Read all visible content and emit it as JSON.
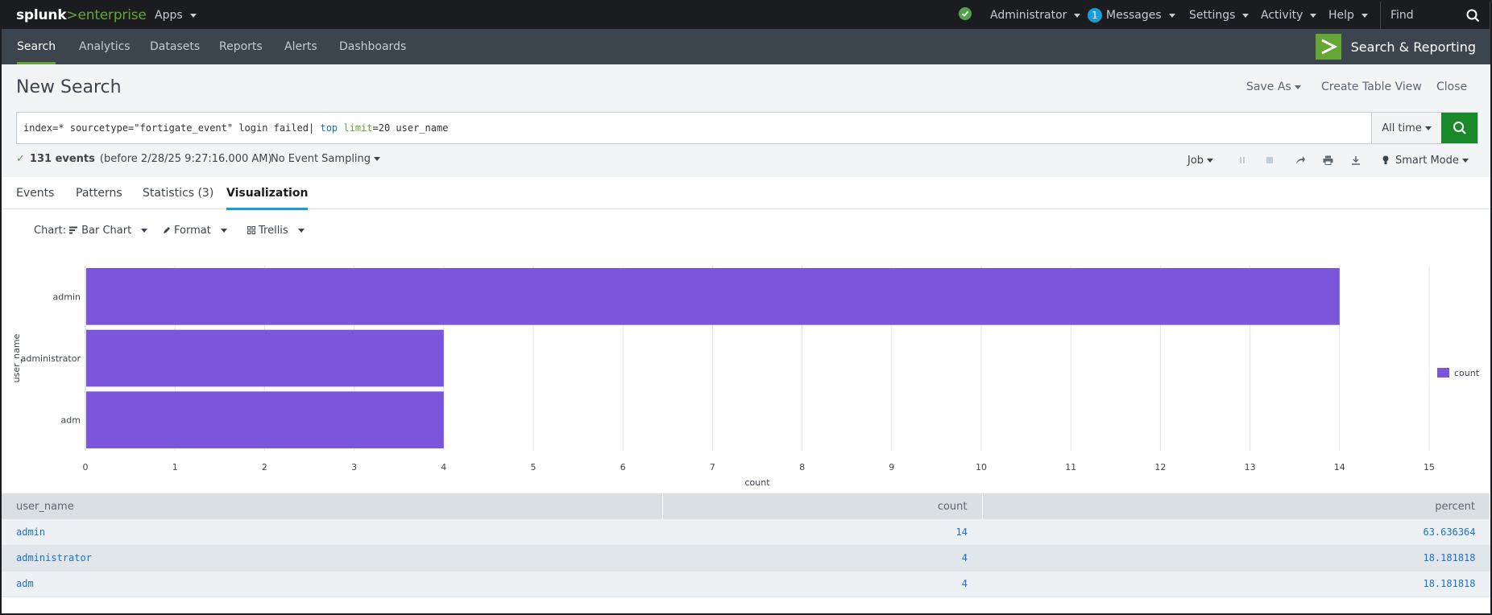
{
  "topbar": {
    "logo_splunk": "splunk",
    "logo_gt": ">",
    "logo_enterprise": "enterprise",
    "apps": "Apps",
    "user": "Administrator",
    "messages_count": "1",
    "messages": "Messages",
    "settings": "Settings",
    "activity": "Activity",
    "help": "Help",
    "find_placeholder": "Find"
  },
  "appbar": {
    "tabs": [
      "Search",
      "Analytics",
      "Datasets",
      "Reports",
      "Alerts",
      "Dashboards"
    ],
    "active_tab": "Search",
    "app_name": "Search & Reporting"
  },
  "search": {
    "page_title": "New Search",
    "save_as": "Save As",
    "create_table_view": "Create Table View",
    "close": "Close",
    "query_part1": "index=* sourcetype=\"fortigate_event\" login failed| ",
    "query_cmd": "top",
    "query_space": " ",
    "query_arg": "limit",
    "query_part2": "=20 user_name",
    "time_range": "All time",
    "events_count": "131 events",
    "events_before": "(before 2/28/25 9:27:16.000 AM)",
    "sampling": "No Event Sampling",
    "job": "Job",
    "mode": "Smart Mode"
  },
  "result_tabs": {
    "events": "Events",
    "patterns": "Patterns",
    "statistics": "Statistics (3)",
    "visualization": "Visualization"
  },
  "viz_toolbar": {
    "chart_label": "Chart:",
    "chart_type": "Bar Chart",
    "format": "Format",
    "trellis": "Trellis"
  },
  "colors": {
    "bar": "#7b56db",
    "accent_green": "#65a637",
    "accent_blue": "#1a9cd9"
  },
  "chart_data": {
    "type": "bar",
    "orientation": "horizontal",
    "categories": [
      "admin",
      "administrator",
      "adm"
    ],
    "series": [
      {
        "name": "count",
        "values": [
          14,
          4,
          4
        ]
      }
    ],
    "xlabel": "count",
    "ylabel": "user_name",
    "xlim": [
      0,
      15
    ],
    "xticks": [
      0,
      1,
      2,
      3,
      4,
      5,
      6,
      7,
      8,
      9,
      10,
      11,
      12,
      13,
      14,
      15
    ],
    "grid": true,
    "legend": "right"
  },
  "table": {
    "columns": [
      "user_name",
      "count",
      "percent"
    ],
    "rows": [
      [
        "admin",
        "14",
        "63.636364"
      ],
      [
        "administrator",
        "4",
        "18.181818"
      ],
      [
        "adm",
        "4",
        "18.181818"
      ]
    ]
  }
}
